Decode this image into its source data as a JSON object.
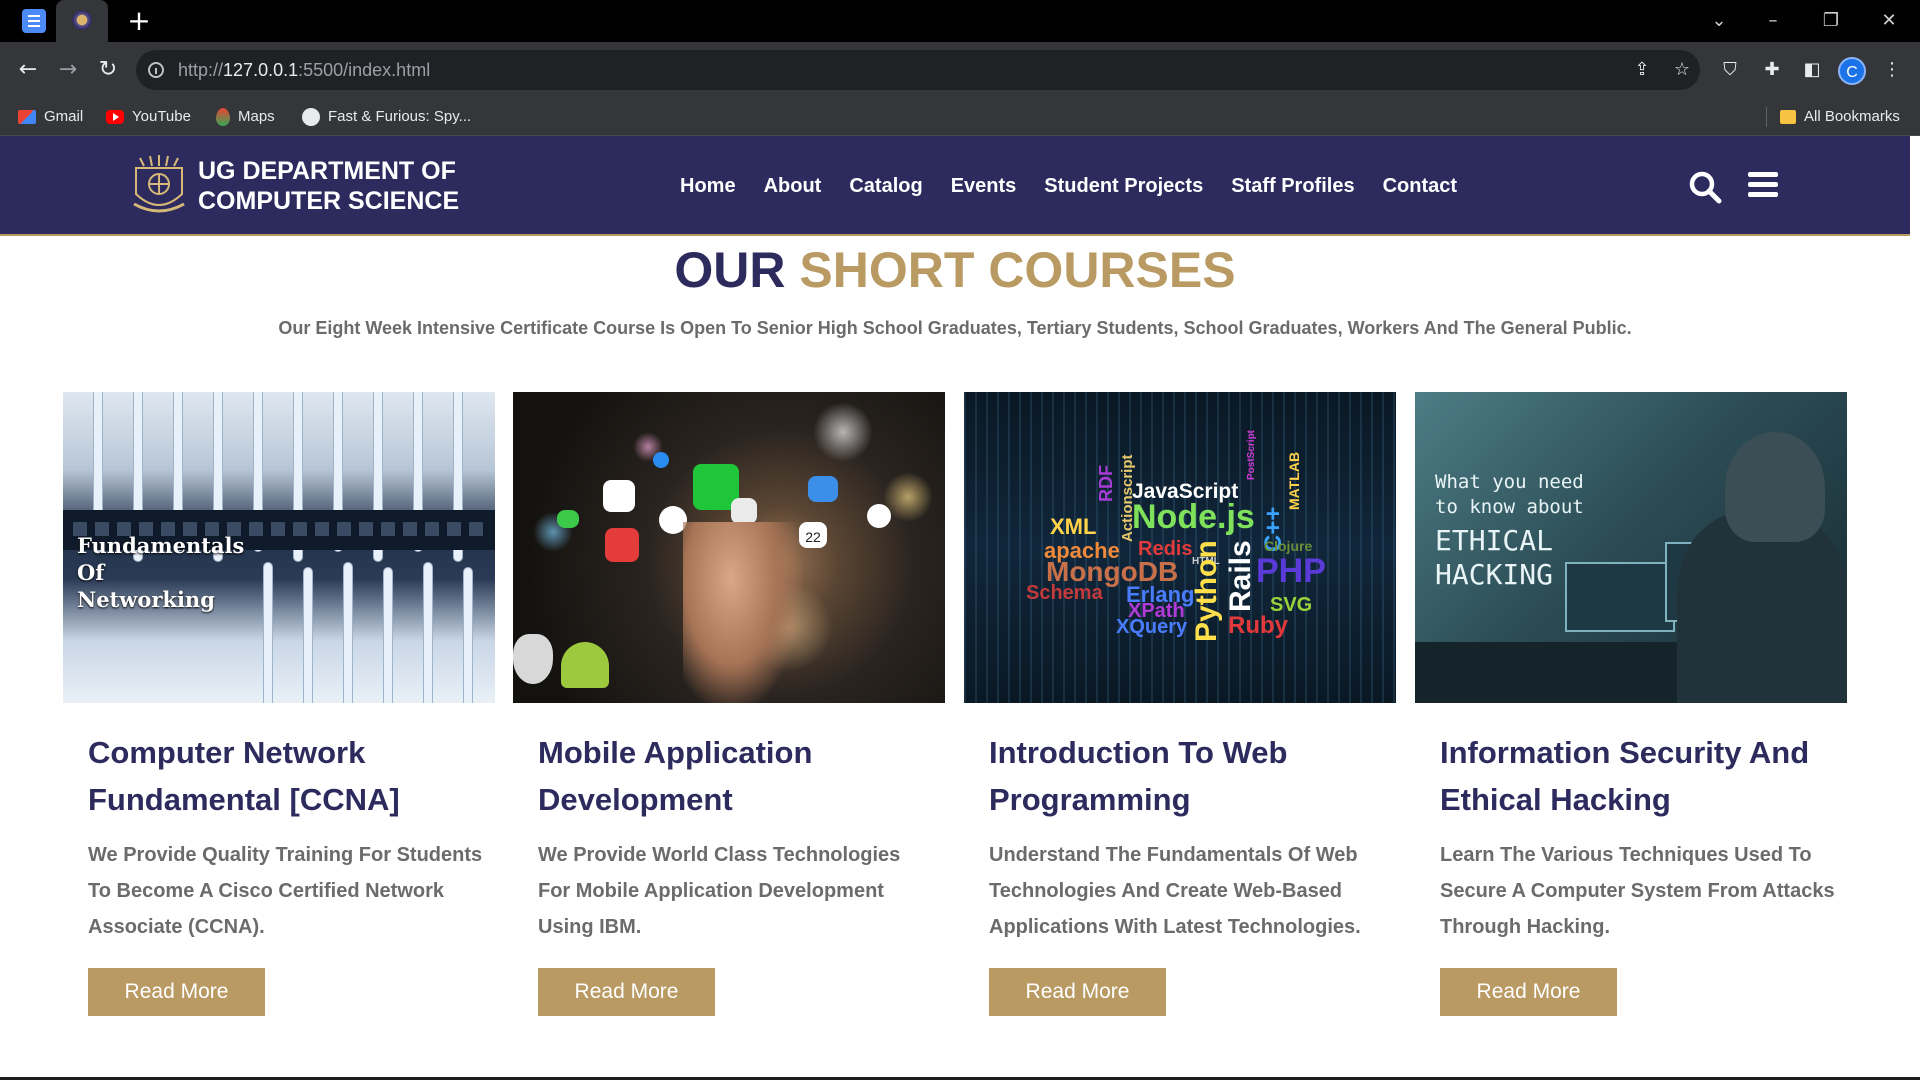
{
  "browser": {
    "url_prefix": "http://",
    "url_host": "127.0.0.1",
    "url_rest": ":5500/index.html",
    "bookmarks": [
      {
        "label": "Gmail",
        "icon": "gmail-icon"
      },
      {
        "label": "YouTube",
        "icon": "youtube-icon"
      },
      {
        "label": "Maps",
        "icon": "maps-icon"
      },
      {
        "label": "Fast & Furious: Spy...",
        "icon": "globe-icon"
      }
    ],
    "all_bookmarks": "All Bookmarks",
    "profile_initial": "C"
  },
  "header": {
    "brand_line1": "UG DEPARTMENT OF",
    "brand_line2": "COMPUTER SCIENCE",
    "nav": [
      "Home",
      "About",
      "Catalog",
      "Events",
      "Student Projects",
      "Staff Profiles",
      "Contact"
    ]
  },
  "section": {
    "title_dark": "OUR",
    "title_gold": "SHORT COURSES",
    "subtitle": "Our Eight Week Intensive Certificate Course Is Open To Senior High School Graduates, Tertiary Students, School Graduates, Workers And The General Public."
  },
  "courses": [
    {
      "title": "Computer Network Fundamental [CCNA]",
      "description": "We Provide Quality Training For Students To Become A Cisco Certified Network Associate (CCNA).",
      "button": "Read More",
      "image_caption": [
        "Fundamentals",
        "Of",
        "Networking"
      ]
    },
    {
      "title": "Mobile Application Development",
      "description": "We Provide World Class Technologies For Mobile Application Development Using IBM.",
      "button": "Read More",
      "image_date": "22"
    },
    {
      "title": "Introduction To Web Programming",
      "description": "Understand The Fundamentals Of Web Technologies And Create Web-Based Applications With Latest Technologies.",
      "button": "Read More",
      "image_words": [
        "XML",
        "RDF",
        "Actionscript",
        "JavaScript",
        "Node.js",
        "C++",
        "MATLAB",
        "apache",
        "Redis",
        "HTML",
        "Rails",
        "Clojure",
        "MongoDB",
        "Python",
        "PHP",
        "Schema",
        "Erlang",
        "XPath",
        "SVG",
        "XQuery",
        "Ruby",
        "PostScript"
      ]
    },
    {
      "title": "Information Security And Ethical Hacking",
      "description": "Learn The Various Techniques Used To Secure A Computer System From Attacks Through Hacking.",
      "button": "Read More",
      "image_caption_small": [
        "What you need",
        "to know about"
      ],
      "image_caption_big": [
        "ETHICAL",
        "HACKING"
      ]
    }
  ],
  "colors": {
    "navy": "#2d2b5e",
    "gold": "#b99a63",
    "body_text": "#6b6b6b"
  }
}
